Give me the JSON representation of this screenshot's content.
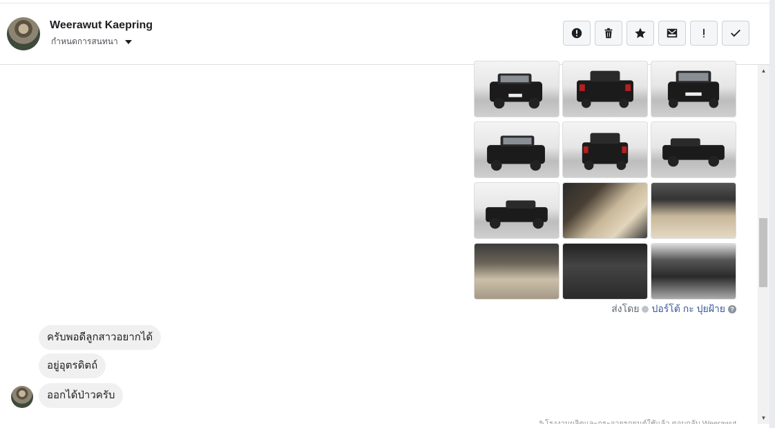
{
  "header": {
    "contact_name": "Weerawut Kaepring",
    "conversation_settings": "กำหนดการสนทนา",
    "actions": [
      {
        "icon": "alert-circle-icon",
        "label": "Report"
      },
      {
        "icon": "trash-icon",
        "label": "Delete"
      },
      {
        "icon": "star-icon",
        "label": "Star"
      },
      {
        "icon": "mark-unread-icon",
        "label": "Mark unread"
      },
      {
        "icon": "exclamation-icon",
        "label": "Spam"
      },
      {
        "icon": "check-icon",
        "label": "Done"
      }
    ]
  },
  "photos": [
    {
      "kind": "studio",
      "desc": "front-left"
    },
    {
      "kind": "studio",
      "desc": "rear"
    },
    {
      "kind": "studio",
      "desc": "front"
    },
    {
      "kind": "studio",
      "desc": "front-left"
    },
    {
      "kind": "studio",
      "desc": "rear"
    },
    {
      "kind": "studio",
      "desc": "side"
    },
    {
      "kind": "studio",
      "desc": "side"
    },
    {
      "kind": "door",
      "desc": "door panel"
    },
    {
      "kind": "dash",
      "desc": "dashboard"
    },
    {
      "kind": "cabin",
      "desc": "cabin"
    },
    {
      "kind": "cluster",
      "desc": "steering wheel"
    },
    {
      "kind": "engine",
      "desc": "engine bay"
    }
  ],
  "sent_by": {
    "prefix": "ส่งโดย",
    "author": "ปอร์โต้ กะ ปุยฝ้าย"
  },
  "messages": [
    "ครับพอดีลูกสาวอยากได้",
    "อยู่อุตรดิตถ์",
    "ออกได้ป่าวครับ"
  ],
  "footnote": "✎โรงงานผลิตและกระจายรถยนต์ใช้แล้ว ตอบกลับ Weerawut",
  "scrollbar": {
    "up": "▲",
    "down": "▼"
  },
  "colors": {
    "link": "#385898",
    "bubble": "#f1f0f0"
  }
}
